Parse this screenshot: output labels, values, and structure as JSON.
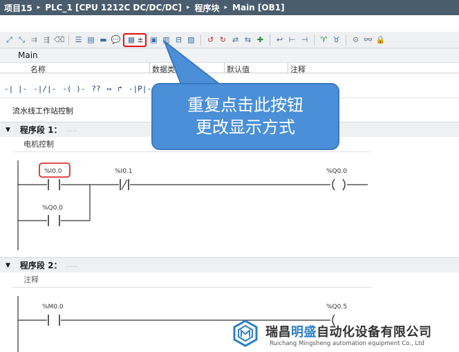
{
  "breadcrumb": {
    "items": [
      "项目15",
      "PLC_1 [CPU 1212C DC/DC/DC]",
      "程序块",
      "Main [OB1]"
    ],
    "separator": "▸"
  },
  "toolbar": {
    "highlighted_button_suffix": "±"
  },
  "block": {
    "name": "Main",
    "interface_columns": [
      "名称",
      "数据类型",
      "默认值",
      "注释"
    ]
  },
  "palette": {
    "instructions": [
      "-| |-",
      "-|/|-",
      "-( )-",
      "??",
      "↦",
      "↱",
      "-|P|-"
    ]
  },
  "block_title": "流水线工作站控制",
  "networks": [
    {
      "label": "程序段 1：",
      "dots": ".....",
      "comment": "电机控制",
      "contacts": [
        {
          "address": "%I0.0",
          "type": "NO",
          "highlighted": true
        },
        {
          "address": "%I0.1",
          "type": "NC",
          "highlighted": false
        },
        {
          "address": "%Q0.0",
          "type": "NO",
          "highlighted": false
        }
      ],
      "coil": {
        "address": "%Q0.0"
      }
    },
    {
      "label": "程序段 2：",
      "dots": ".....",
      "comment": "注释",
      "contacts": [
        {
          "address": "%M0.0",
          "type": "NO",
          "highlighted": false
        }
      ],
      "coil": {
        "address": "%Q0.5"
      }
    }
  ],
  "callout": {
    "line1": "重复点击此按钮",
    "line2": "更改显示方式",
    "color": "#4a8fd8"
  },
  "watermark": {
    "cn_prefix": "瑞昌",
    "cn_highlight": "明盛",
    "cn_suffix": "自动化设备有限公司",
    "en": "Ruichang Mingsheng automation equipment Co., Ltd",
    "highlight_color": "#2d7fc7"
  }
}
